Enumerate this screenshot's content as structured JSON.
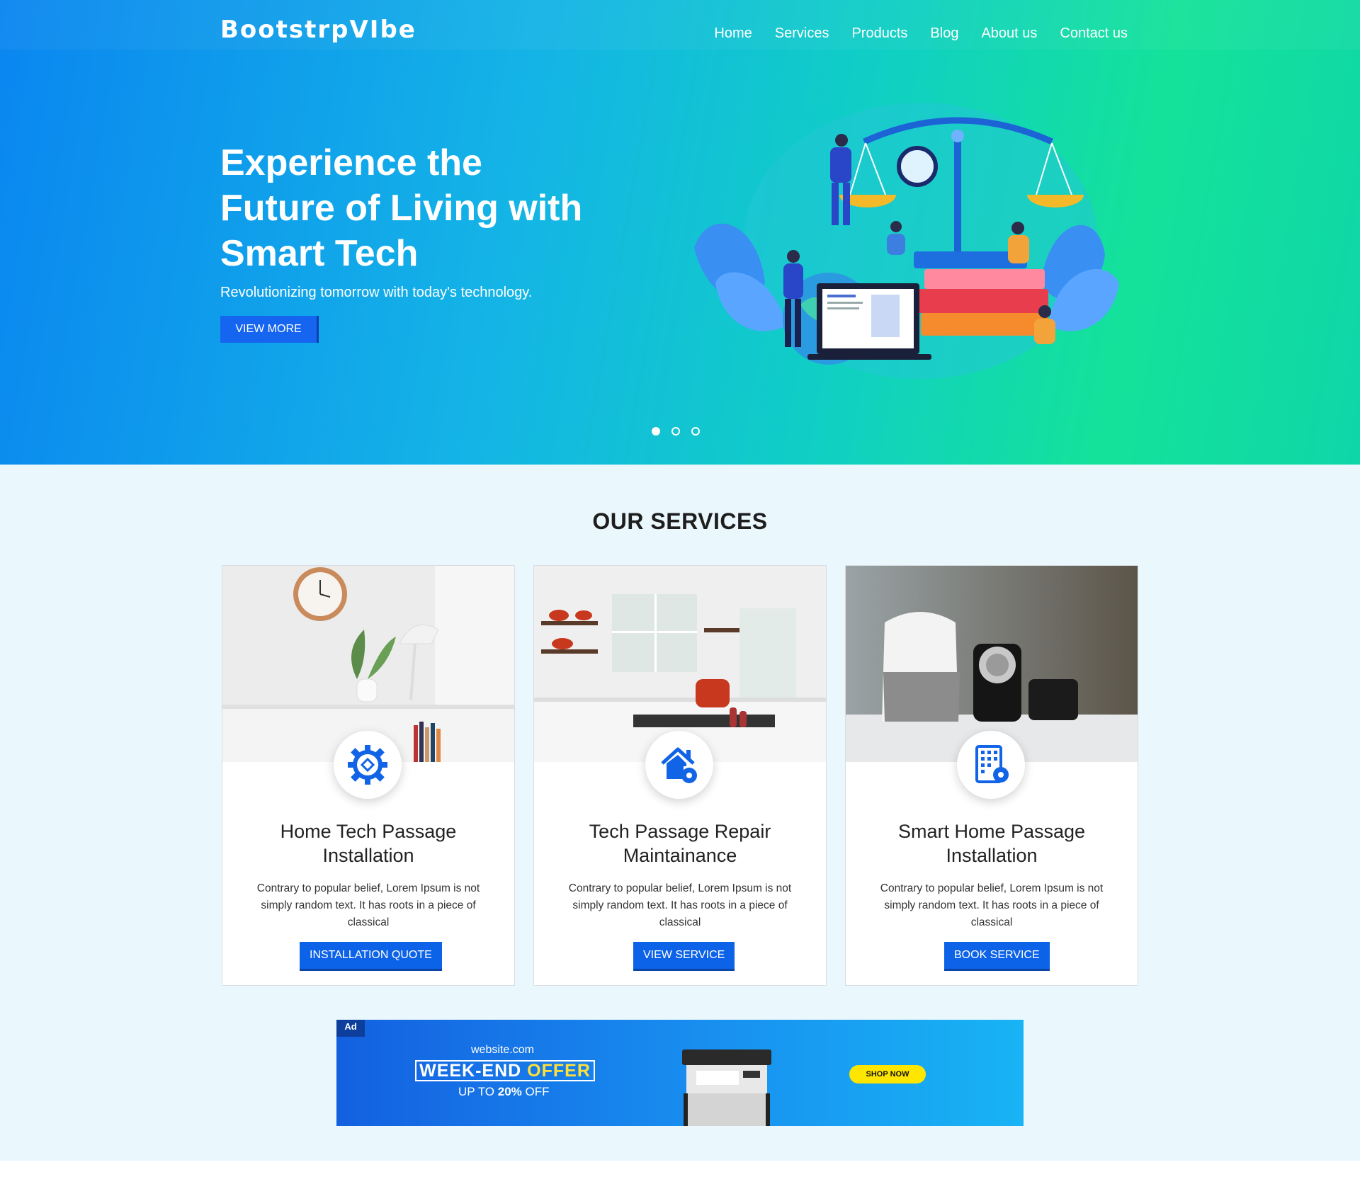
{
  "header": {
    "logo": "BootstrpVIbe",
    "nav": [
      "Home",
      "Services",
      "Products",
      "Blog",
      "About us",
      "Contact us"
    ]
  },
  "hero": {
    "title": "Experience the Future of Living with Smart Tech",
    "subtitle": "Revolutionizing tomorrow with today's technology.",
    "cta": "VIEW MORE",
    "carousel": {
      "slides": 3,
      "active": 1
    }
  },
  "services": {
    "heading": "OUR SERVICES",
    "cards": [
      {
        "icon": "gear-icon",
        "title": "Home Tech Passage Installation",
        "text": "Contrary to popular belief, Lorem Ipsum is not simply random text. It has roots in a piece of classical",
        "button": "INSTALLATION QUOTE"
      },
      {
        "icon": "home-gear-icon",
        "title": "Tech Passage Repair Maintainance",
        "text": "Contrary to popular belief, Lorem Ipsum is not simply random text. It has roots in a piece of classical",
        "button": "VIEW SERVICE"
      },
      {
        "icon": "building-gear-icon",
        "title": "Smart Home Passage Installation",
        "text": "Contrary to popular belief, Lorem Ipsum is not simply random text. It has roots in a piece of classical",
        "button": "BOOK SERVICE"
      }
    ]
  },
  "ad": {
    "badge": "Ad",
    "site": "website.com",
    "offer_white": "WEEK-END",
    "offer_yellow": "OFFER",
    "upto_prefix": "UP TO",
    "upto_value": "20%",
    "upto_suffix": "OFF",
    "cta": "SHOP NOW"
  },
  "colors": {
    "primary": "#0d63e8",
    "hero_start": "#0a86f0",
    "hero_end": "#14e29a",
    "section_bg": "#eaf7fd",
    "offer_yellow": "#ffe03a"
  }
}
